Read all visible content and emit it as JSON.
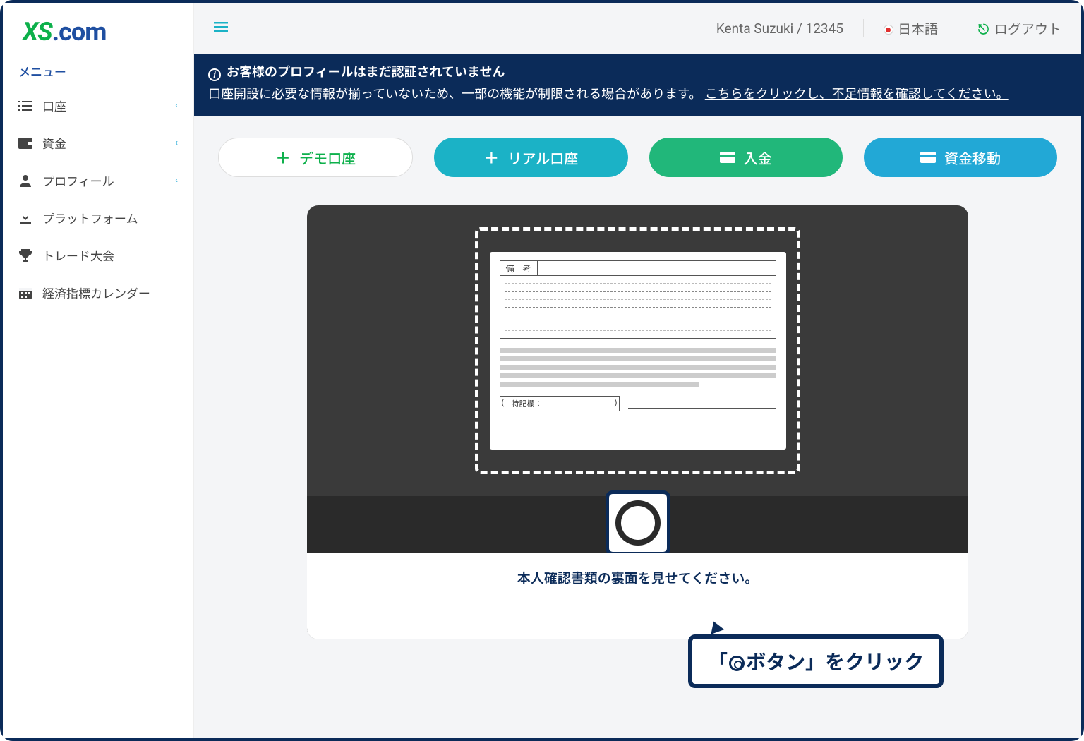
{
  "logo": {
    "xs": "XS",
    "dot": ".",
    "com": "com"
  },
  "menu_title": "メニュー",
  "sidebar": {
    "items": [
      {
        "label": "口座",
        "icon": "list",
        "expandable": true
      },
      {
        "label": "資金",
        "icon": "wallet",
        "expandable": true
      },
      {
        "label": "プロフィール",
        "icon": "user",
        "expandable": true
      },
      {
        "label": "プラットフォーム",
        "icon": "download",
        "expandable": false
      },
      {
        "label": "トレード大会",
        "icon": "trophy",
        "expandable": false
      },
      {
        "label": "経済指標カレンダー",
        "icon": "calendar",
        "expandable": false
      }
    ]
  },
  "topbar": {
    "user": "Kenta Suzuki / 12345",
    "language": "日本語",
    "logout": "ログアウト"
  },
  "notice": {
    "title": "お客様のプロフィールはまだ認証されていません",
    "body_prefix": "口座開設に必要な情報が揃っていないため、一部の機能が制限される場合があります。 ",
    "link": "こちらをクリックし、不足情報を確認してください。"
  },
  "actions": {
    "demo": "デモ口座",
    "real": "リアル口座",
    "deposit": "入金",
    "transfer": "資金移動"
  },
  "capture": {
    "doc_label": "備　考",
    "tokki_label": "特記欄：",
    "footer_text": "本人確認書類の裏面を見せてください。",
    "tooltip_prefix": "「",
    "tooltip_button": "ボタン」をクリック"
  }
}
